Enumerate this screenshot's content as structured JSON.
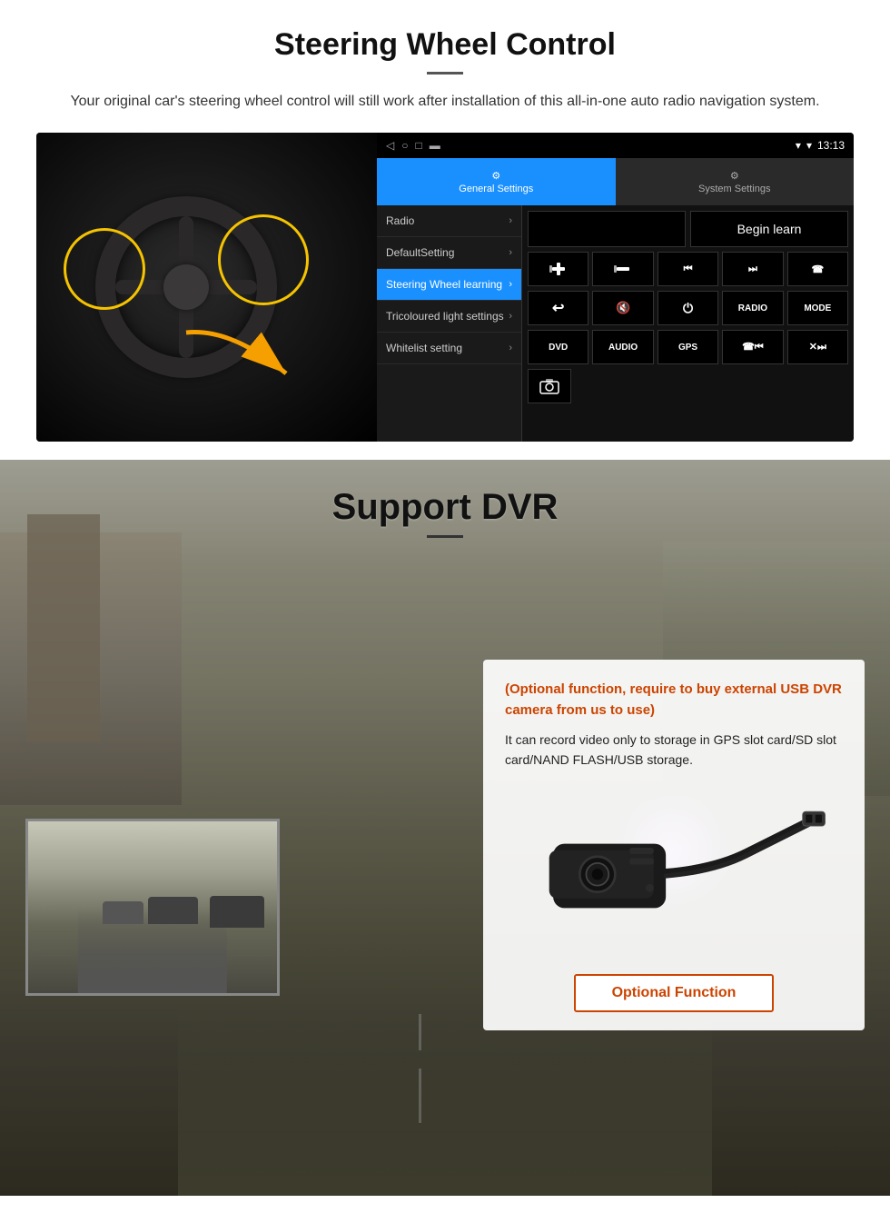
{
  "steering": {
    "title": "Steering Wheel Control",
    "subtitle": "Your original car's steering wheel control will still work after installation of this all-in-one auto radio navigation system.",
    "statusbar": {
      "time": "13:13",
      "icons": [
        "▾",
        "▾"
      ]
    },
    "tabs": {
      "general": "General Settings",
      "system": "System Settings"
    },
    "menu": [
      {
        "label": "Radio",
        "active": false
      },
      {
        "label": "DefaultSetting",
        "active": false
      },
      {
        "label": "Steering Wheel learning",
        "active": true
      },
      {
        "label": "Tricoloured light settings",
        "active": false
      },
      {
        "label": "Whitelist setting",
        "active": false
      }
    ],
    "begin_learn": "Begin learn",
    "controls": {
      "row1": [
        "vol+",
        "vol-",
        "⏮",
        "⏭",
        "☎"
      ],
      "row2": [
        "↩",
        "🔇",
        "⏻",
        "RADIO",
        "MODE"
      ],
      "row3": [
        "DVD",
        "AUDIO",
        "GPS",
        "☎⏮",
        "✕⏭"
      ],
      "row4": [
        "📷"
      ]
    }
  },
  "dvr": {
    "title": "Support DVR",
    "optional_text": "(Optional function, require to buy external USB DVR camera from us to use)",
    "description": "It can record video only to storage in GPS slot card/SD slot card/NAND FLASH/USB storage.",
    "optional_function_label": "Optional Function"
  }
}
